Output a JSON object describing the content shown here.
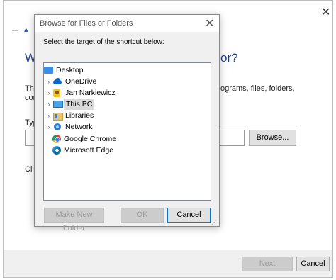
{
  "wizard": {
    "heading_left": "Wh",
    "heading_right": "or?",
    "desc_left": "This",
    "desc_right": "ograms, files, folders,",
    "desc2": "con",
    "type_label": "Typ",
    "browse_label": "Browse...",
    "click_label": "Clic",
    "next_label": "Next",
    "cancel_label": "Cancel"
  },
  "dialog": {
    "title": "Browse for Files or Folders",
    "prompt": "Select the target of the shortcut below:",
    "tree": [
      {
        "label": "Desktop",
        "icon": "desktop-icon",
        "expandable": false
      },
      {
        "label": "OneDrive",
        "icon": "onedrive-icon",
        "expandable": true
      },
      {
        "label": "Jan Narkiewicz",
        "icon": "user-folder-icon",
        "expandable": true
      },
      {
        "label": "This PC",
        "icon": "computer-icon",
        "expandable": true,
        "selected": true
      },
      {
        "label": "Libraries",
        "icon": "library-icon",
        "expandable": true
      },
      {
        "label": "Network",
        "icon": "network-icon",
        "expandable": true
      },
      {
        "label": "Google Chrome",
        "icon": "chrome-icon",
        "expandable": false
      },
      {
        "label": "Microsoft Edge",
        "icon": "edge-icon",
        "expandable": false
      }
    ],
    "new_folder_label": "Make New Folder",
    "ok_label": "OK",
    "cancel_label": "Cancel"
  }
}
